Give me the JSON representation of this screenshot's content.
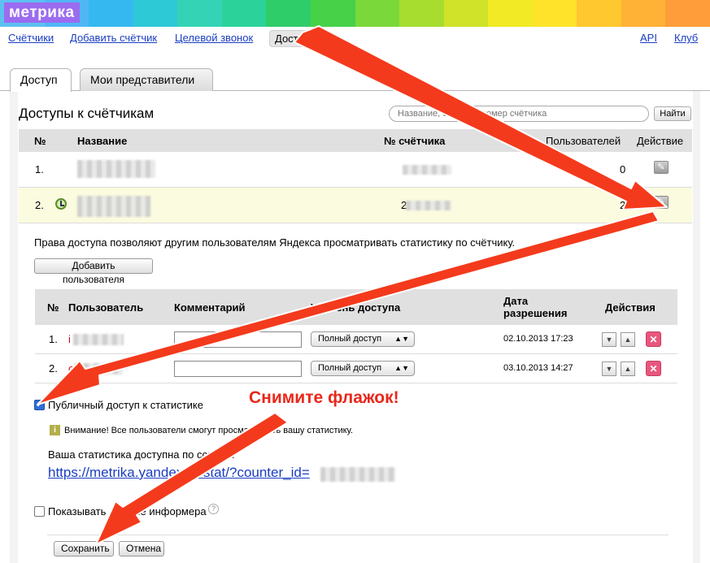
{
  "brand": {
    "logo": "метрика"
  },
  "colors": {
    "band": [
      "#5dc1f0",
      "#4fb7f5",
      "#35b8f0",
      "#2ec9d6",
      "#34d3b5",
      "#2bd39a",
      "#2fcc6a",
      "#46d148",
      "#7bd83a",
      "#a6dd2f",
      "#d0e329",
      "#f1ea24",
      "#ffe32a",
      "#ffc82e",
      "#ffb235",
      "#ff9d3a"
    ],
    "annotation": "#e8281b",
    "arrow": "#f43a1c"
  },
  "topnav": {
    "counters": "Счётчики",
    "add_counter": "Добавить счётчик",
    "target_call": "Целевой звонок",
    "access": "Доступы",
    "api": "API",
    "club": "Клуб"
  },
  "tabs": {
    "access": "Доступ",
    "representatives": "Мои представители"
  },
  "page": {
    "title": "Доступы к счётчикам"
  },
  "search": {
    "placeholder": "Название, сайт или номер счётчика",
    "button": "Найти"
  },
  "counters_table": {
    "headers": {
      "num": "№",
      "name": "Название",
      "counter_id": "№ счётчика",
      "users": "Пользователей",
      "action": "Действие"
    },
    "rows": [
      {
        "num": "1.",
        "users": "0"
      },
      {
        "num": "2.",
        "users": "2",
        "id_prefix": "2"
      }
    ]
  },
  "rights_text": "Права доступа позволяют другим пользователям Яндекса просматривать статистику по счётчику.",
  "add_user_button": "Добавить пользователя",
  "users_table": {
    "headers": {
      "num": "№",
      "user": "Пользователь",
      "comment": "Комментарий",
      "level": "Уровень доступа",
      "date": "Дата разрешения",
      "actions": "Действия"
    },
    "rows": [
      {
        "num": "1.",
        "user_initial": "i",
        "level": "Полный доступ",
        "date": "02.10.2013 17:23"
      },
      {
        "num": "2.",
        "user_initial": "c",
        "level": "Полный доступ",
        "date": "03.10.2013 14:27"
      }
    ]
  },
  "public_access": {
    "label": "Публичный доступ к статистике",
    "checked": true
  },
  "warning": "Внимание! Все пользователи смогут просматривать вашу статистику.",
  "stat_link": {
    "caption": "Ваша статистика доступна по ссылке:",
    "url": "https://metrika.yandex.ru/stat/?counter_id="
  },
  "informer": {
    "label": "Показывать данные информера",
    "checked": false,
    "help": "?"
  },
  "buttons": {
    "save": "Сохранить",
    "cancel": "Отмена"
  },
  "annotation": "Снимите флажок!"
}
